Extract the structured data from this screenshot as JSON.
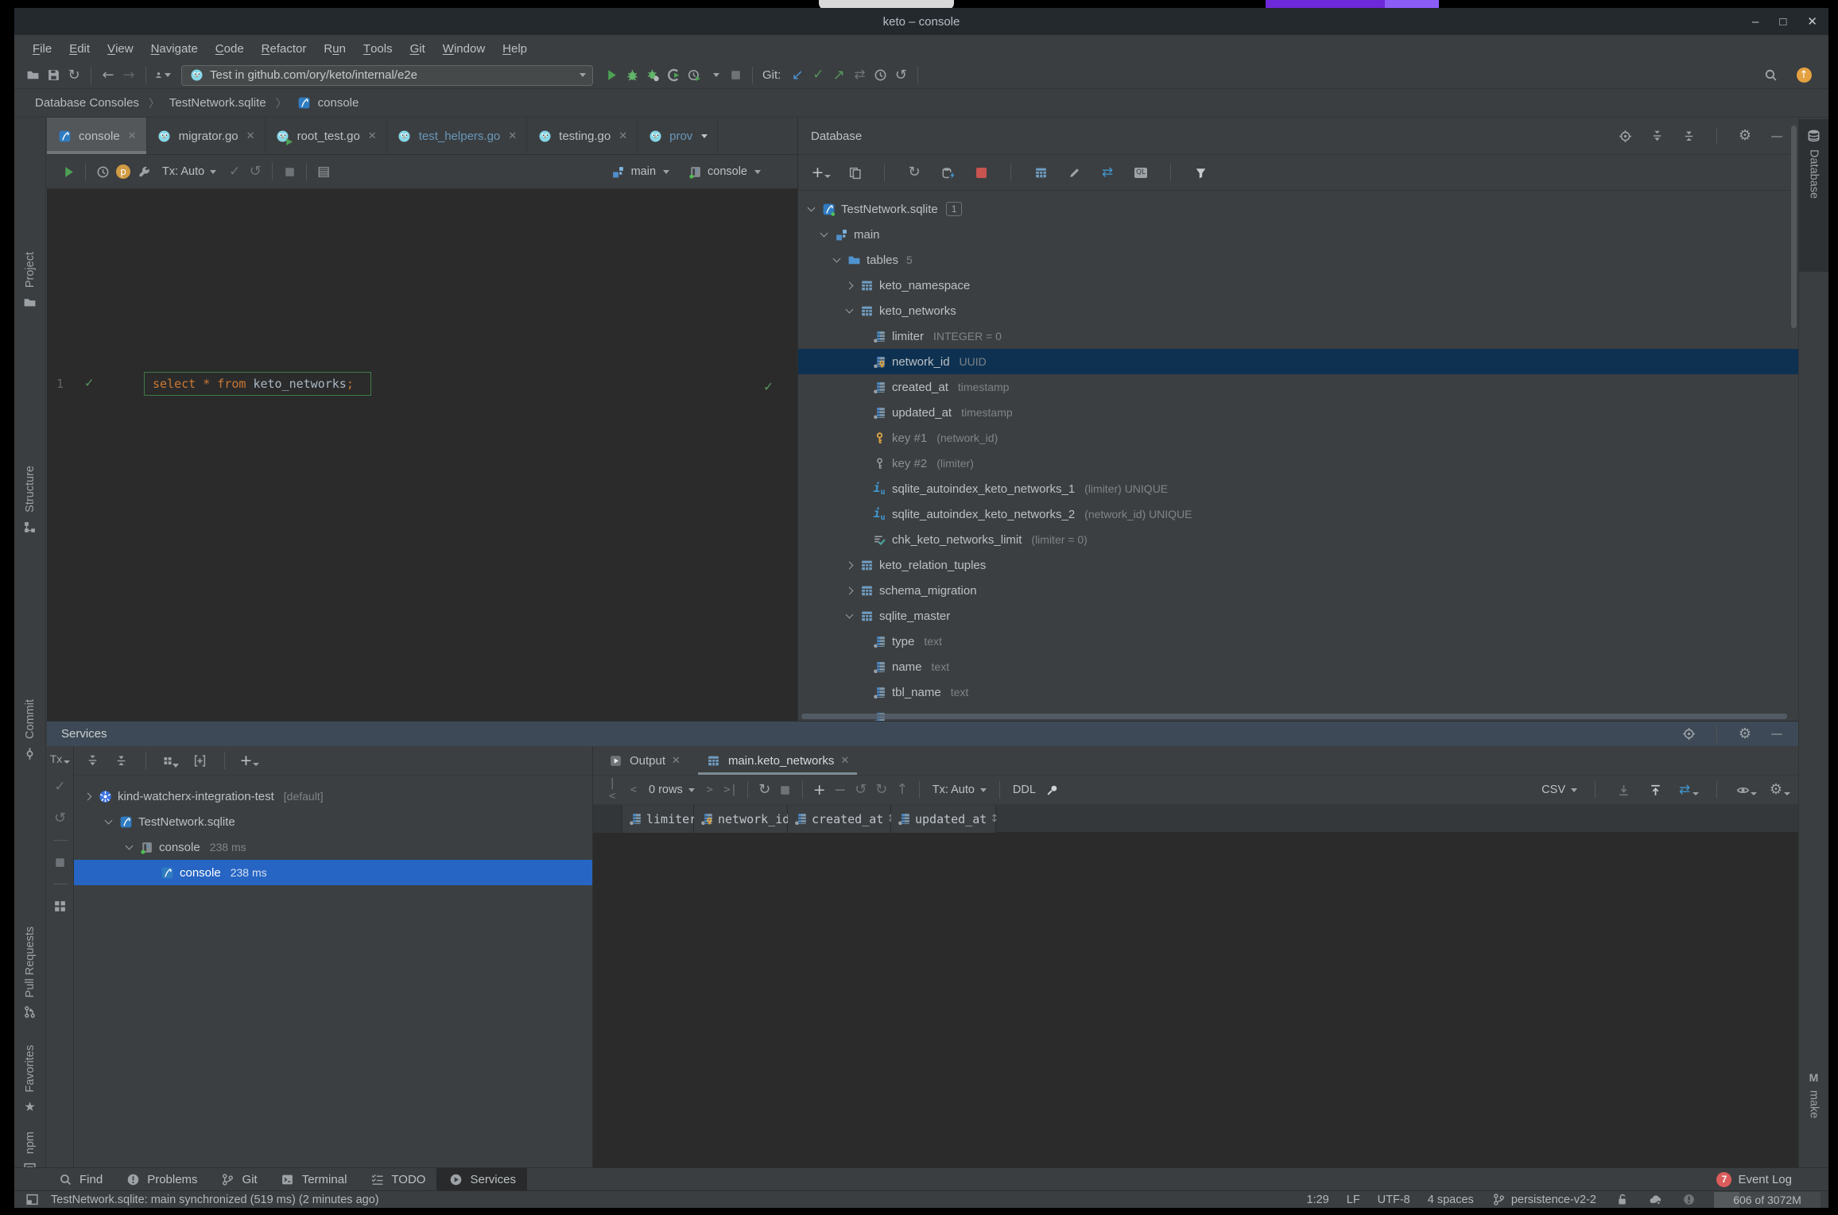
{
  "window": {
    "title": "keto – console",
    "controls": [
      "minimize",
      "maximize",
      "close"
    ]
  },
  "menu": {
    "items": [
      {
        "label": "File",
        "mnemonic": 0
      },
      {
        "label": "Edit",
        "mnemonic": 0
      },
      {
        "label": "View",
        "mnemonic": 0
      },
      {
        "label": "Navigate",
        "mnemonic": 0
      },
      {
        "label": "Code",
        "mnemonic": 0
      },
      {
        "label": "Refactor",
        "mnemonic": 0
      },
      {
        "label": "Run",
        "mnemonic": 1
      },
      {
        "label": "Tools",
        "mnemonic": 0
      },
      {
        "label": "Git",
        "mnemonic": 0
      },
      {
        "label": "Window",
        "mnemonic": 0
      },
      {
        "label": "Help",
        "mnemonic": 0
      }
    ]
  },
  "main_toolbar": {
    "left_icons": [
      "open-folder",
      "save",
      "sync",
      "divider",
      "back",
      "forward",
      "divider",
      "user-dropdown"
    ],
    "run_config": {
      "icon": "test-gopher",
      "label": "Test in github.com/ory/keto/internal/e2e"
    },
    "run_icons": [
      "run",
      "debug",
      "coverage",
      "profiler",
      "profile-clock",
      "dropdown",
      "stop"
    ],
    "git_label": "Git:",
    "git_icons": [
      "update-project",
      "commit-check",
      "push",
      "diff",
      "history",
      "rollback"
    ],
    "right_icons": [
      "search",
      "update-app"
    ]
  },
  "breadcrumbs": {
    "items": [
      {
        "label": "Database Consoles"
      },
      {
        "label": "TestNetwork.sqlite"
      },
      {
        "label": "console",
        "icon": "sqlite-file"
      }
    ]
  },
  "left_strip": {
    "top": [
      {
        "label": "Project",
        "icon": "project"
      },
      {
        "label": "Structure",
        "icon": "structure"
      },
      {
        "label": "Commit",
        "icon": "commit-node"
      },
      {
        "label": "Pull Requests",
        "icon": "pull-request"
      }
    ],
    "bottom": [
      {
        "label": "Favorites",
        "icon": "star"
      },
      {
        "label": "npm",
        "icon": "npm"
      }
    ]
  },
  "right_strip": {
    "top": {
      "label": "Database",
      "icon": "database-cyl"
    },
    "bottom": {
      "label": "make",
      "icon_letter": "M"
    }
  },
  "editor": {
    "tabs": [
      {
        "label": "console",
        "icon": "sqlite-file",
        "selected": true
      },
      {
        "label": "migrator.go",
        "icon": "gopher"
      },
      {
        "label": "root_test.go",
        "icon": "gopher-run"
      },
      {
        "label": "test_helpers.go",
        "icon": "gopher",
        "modified": true
      },
      {
        "label": "testing.go",
        "icon": "gopher"
      },
      {
        "label": "prov",
        "icon": "gopher",
        "modified": true,
        "dropdown": true
      }
    ],
    "toolbar": {
      "left_icons": [
        "run",
        "divider",
        "history",
        "profile-p",
        "wrench"
      ],
      "tx_label": "Tx: Auto",
      "mid_icons": [
        "check-dim",
        "rollback-dim",
        "divider",
        "stop",
        "divider",
        "output-layout"
      ],
      "schema": {
        "icon": "schema",
        "label": "main"
      },
      "session": {
        "icon": "console-session",
        "label": "console"
      }
    },
    "gutter_line": "1",
    "code_tokens": [
      {
        "text": "select",
        "type": "keyword"
      },
      {
        "text": " ",
        "type": "plain"
      },
      {
        "text": "*",
        "type": "keyword"
      },
      {
        "text": " ",
        "type": "plain"
      },
      {
        "text": "from",
        "type": "keyword"
      },
      {
        "text": " ",
        "type": "plain"
      },
      {
        "text": "keto_networks",
        "type": "ident"
      },
      {
        "text": ";",
        "type": "keyword"
      }
    ]
  },
  "database_panel": {
    "title": "Database",
    "header_icons": [
      "locate",
      "expand-all",
      "collapse-all",
      "divider",
      "settings",
      "hide"
    ],
    "toolbar_icons": [
      "add-dd",
      "duplicate",
      "divider",
      "refresh",
      "sync-schema",
      "stop-red",
      "divider",
      "open-table",
      "edit",
      "jump-console",
      "ql-console",
      "divider",
      "filter"
    ],
    "tree": [
      {
        "level": 0,
        "state": "expanded",
        "icon": "sqlite-db",
        "label": "TestNetwork.sqlite",
        "badge": "1"
      },
      {
        "level": 1,
        "state": "expanded",
        "icon": "schema",
        "label": "main"
      },
      {
        "level": 2,
        "state": "expanded",
        "icon": "folder",
        "label": "tables",
        "count": "5"
      },
      {
        "level": 3,
        "state": "collapsed",
        "icon": "table",
        "label": "keto_namespace"
      },
      {
        "level": 3,
        "state": "expanded",
        "icon": "table",
        "label": "keto_networks"
      },
      {
        "level": 4,
        "icon": "column",
        "label": "limiter",
        "detail": "INTEGER = 0"
      },
      {
        "level": 4,
        "icon": "column-key",
        "label": "network_id",
        "detail": "UUID",
        "selected": true
      },
      {
        "level": 4,
        "icon": "column",
        "label": "created_at",
        "detail": "timestamp"
      },
      {
        "level": 4,
        "icon": "column",
        "label": "updated_at",
        "detail": "timestamp"
      },
      {
        "level": 4,
        "icon": "key-gold",
        "label": "key #1",
        "detail": "(network_id)",
        "dim": true
      },
      {
        "level": 4,
        "icon": "key-outline",
        "label": "key #2",
        "detail": "(limiter)",
        "dim": true
      },
      {
        "level": 4,
        "icon": "index",
        "label": "sqlite_autoindex_keto_networks_1",
        "detail": "(limiter) UNIQUE"
      },
      {
        "level": 4,
        "icon": "index",
        "label": "sqlite_autoindex_keto_networks_2",
        "detail": "(network_id) UNIQUE"
      },
      {
        "level": 4,
        "icon": "check-constraint",
        "label": "chk_keto_networks_limit",
        "detail": "(limiter = 0)"
      },
      {
        "level": 3,
        "state": "collapsed",
        "icon": "table",
        "label": "keto_relation_tuples"
      },
      {
        "level": 3,
        "state": "collapsed",
        "icon": "table",
        "label": "schema_migration"
      },
      {
        "level": 3,
        "state": "expanded",
        "icon": "table",
        "label": "sqlite_master"
      },
      {
        "level": 4,
        "icon": "column",
        "label": "type",
        "detail": "text"
      },
      {
        "level": 4,
        "icon": "column",
        "label": "name",
        "detail": "text"
      },
      {
        "level": 4,
        "icon": "column",
        "label": "tbl_name",
        "detail": "text"
      },
      {
        "level": 4,
        "icon": "column",
        "label": "",
        "detail": "",
        "clipped": true
      }
    ]
  },
  "services_panel": {
    "title": "Services",
    "header_icons": [
      "locate",
      "divider",
      "settings",
      "hide"
    ],
    "side_toolbar": {
      "tx_label": "Tx",
      "icons": [
        "check-dim",
        "rollback-dim",
        "divider-h",
        "stop",
        "divider-h",
        "grid"
      ]
    },
    "top_toolbar_icons": [
      "expand-all",
      "collapse-all",
      "divider",
      "group-by",
      "add-service",
      "divider",
      "add-dd"
    ],
    "tree": [
      {
        "level": 0,
        "state": "collapsed",
        "icon": "kubernetes",
        "label": "kind-watcherx-integration-test",
        "detail": "[default]"
      },
      {
        "level": 1,
        "state": "expanded",
        "icon": "sqlite-file",
        "label": "TestNetwork.sqlite"
      },
      {
        "level": 2,
        "state": "expanded",
        "icon": "console-session",
        "label": "console",
        "detail": "238 ms"
      },
      {
        "level": 3,
        "icon": "sqlite-file",
        "label": "console",
        "detail": "238 ms",
        "selected": true
      }
    ],
    "output_tabs": [
      {
        "label": "Output",
        "icon": "run-tab"
      },
      {
        "label": "main.keto_networks",
        "icon": "table",
        "selected": true
      }
    ],
    "grid_toolbar": {
      "rows_label": "0 rows",
      "tx_label": "Tx: Auto",
      "ddl_label": "DDL",
      "format_label": "CSV"
    },
    "grid_columns": [
      {
        "name": "limiter",
        "icon": "column"
      },
      {
        "name": "network_id",
        "icon": "column-key"
      },
      {
        "name": "created_at",
        "icon": "column"
      },
      {
        "name": "updated_at",
        "icon": "column"
      }
    ]
  },
  "bottom_bar": {
    "items": [
      {
        "label": "Find",
        "icon": "find"
      },
      {
        "label": "Problems",
        "icon": "problems"
      },
      {
        "label": "Git",
        "icon": "git-branch"
      },
      {
        "label": "Terminal",
        "icon": "terminal"
      },
      {
        "label": "TODO",
        "icon": "todo"
      },
      {
        "label": "Services",
        "icon": "services",
        "selected": true
      }
    ],
    "event_log": {
      "count": "7",
      "label": "Event Log"
    }
  },
  "status_bar": {
    "message": "TestNetwork.sqlite: main synchronized (519 ms) (2 minutes ago)",
    "items": [
      {
        "label": "1:29"
      },
      {
        "label": "LF"
      },
      {
        "label": "UTF-8"
      },
      {
        "label": "4 spaces"
      },
      {
        "label": "persistence-v2-2",
        "icon": "git-branch"
      }
    ],
    "trailing_icons": [
      "unlock",
      "cloud-settings",
      "info"
    ],
    "memory": "606 of 3072M"
  },
  "colors": {
    "accent_blue": "#2665c4",
    "tree_selection": "#0e3151",
    "keyword_orange": "#cc7832",
    "modified_file_blue": "#6897bb",
    "run_green": "#4da155",
    "error_red": "#c75450",
    "key_gold": "#d9a343",
    "focused_header": "#3d4956",
    "panel_bg": "#3c3f41",
    "editor_bg": "#2b2b2b"
  }
}
